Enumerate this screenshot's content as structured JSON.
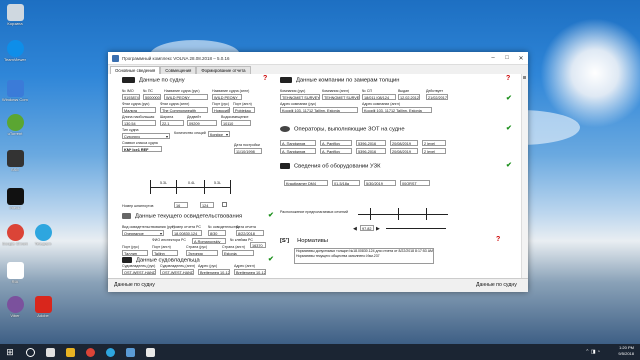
{
  "desktop": {
    "icons": [
      {
        "label": "Корзина",
        "color": "#cfd8e0"
      },
      {
        "label": "TeamViewer",
        "color": "#0e8ee9"
      },
      {
        "label": "Windows Comp.",
        "color": "#3b7bd8"
      },
      {
        "label": "uTorrent",
        "color": "#5ba632"
      },
      {
        "label": "SSE",
        "color": "#333333"
      },
      {
        "label": "IntelliJ",
        "color": "#111111"
      },
      {
        "label": "Google Chrome",
        "color": "#db4437"
      },
      {
        "label": "Telegram",
        "color": "#2ea6df"
      },
      {
        "label": "RIA",
        "color": "#ffffff"
      },
      {
        "label": "Viber",
        "color": "#7b519d"
      },
      {
        "label": "Adobe",
        "color": "#d9261c"
      }
    ]
  },
  "window": {
    "title": "Программный комплекс VOLNA 28.08.2018 – 5.0.16",
    "tabs": [
      "Основные сведения",
      "Совмещения",
      "Формирование отчета"
    ],
    "footer_left": "Данные по судну",
    "footer_right": "Данные по судну"
  },
  "vessel": {
    "title": "Данные по судну",
    "lbl_imo": "№ IMO",
    "imo": "9193874",
    "lbl_no": "№ ПС",
    "no": "5000000",
    "lbl_name": "Название судна (рус)",
    "name": "WILD PEONY",
    "lbl_name_en": "Название судна (англ)",
    "name_en": "WILD PEONY",
    "lbl_flag_ru": "Флаг судна (рус)",
    "flag_ru": "Мальта",
    "lbl_flag_en": "Флаг судна (англ)",
    "flag_en": "The Commonwealth",
    "lbl_port_ru": "Порт (рус)",
    "port_ru": "Новосиб",
    "lbl_port_en": "Порт (англ)",
    "port_en": "Pobiekau",
    "lbl_len": "Длина наибольшая",
    "len": "130.54",
    "lbl_wid": "Ширина",
    "wid": "22.1",
    "lbl_dead": "Дедвейт",
    "dead": "09209",
    "lbl_disp": "Водоизмещение",
    "disp": "10110",
    "lbl_type": "Тип судна",
    "type": "Сухогруз",
    "lbl_sect": "Количество секций",
    "sect": "Конфиг",
    "lbl_class": "Символ класса судна",
    "class": "KM* Ice1 REF",
    "lbl_date": "Дата постройки",
    "date": "11/10/1998",
    "lbl_num": "Номер шпангоутов",
    "num1": "16",
    "num2": "124",
    "d1": "5.3L",
    "d2": "0.4L",
    "d3": "5.3L"
  },
  "company": {
    "title": "Данные компании по замерам толщин",
    "lbl_comp_ru": "Компания (рус)",
    "comp_ru": "TEHNOMET SURVEY",
    "lbl_comp_en": "Компания (англ)",
    "comp_en": "TEHNOMET SURVEY",
    "lbl_cert": "№ СП",
    "cert": "18/011 I08/124",
    "lbl_issued": "Выдан",
    "issued": "12.02.2012",
    "lbl_valid": "Действует",
    "valid": "21/02/2017",
    "lbl_addr_ru": "Адрес компании (рус)",
    "addr_ru": "Kooplii 103, 11712 Tallinn, Estonia",
    "lbl_addr_en": "Адрес компании (англ)",
    "addr_en": "Kooplii 103, 11712 Tallinn, Estonia"
  },
  "operators": {
    "title": "Операторы, выполняющие ЗОТ на судне",
    "rows": [
      {
        "ru": "А. Панфилов",
        "en": "A. Panfilov",
        "no": "5396-2016",
        "date": "20/08/2019",
        "level": "2 level"
      },
      {
        "ru": "А. Панфилов",
        "en": "A. Panfilov",
        "no": "5396-2016",
        "date": "20/08/2019",
        "level": "2 level"
      }
    ]
  },
  "equipment": {
    "title": "Сведения об оборудовании УЗК",
    "name": "Krautkramer DM4",
    "serial": "01-5/18a",
    "date": "5/30/2019",
    "cert": "00ORST"
  },
  "certificate": {
    "title": "Данные текущего освидетельствования",
    "lbl_kind": "Вид освидетельствования (рус)",
    "kind": "Очередное",
    "lbl_report": "Номер отчета РС",
    "report": "18.00830.124",
    "lbl_survey": "№ освидетельство",
    "survey": "8/30",
    "lbl_date": "Дата отчета",
    "date": "8/22/2018",
    "lbl_insp": "ФИО инспектора РС",
    "insp": "А.Romanovskiy",
    "lbl_insp_no": "№ клейма РС",
    "insp_no": "16370",
    "lbl_place_ru": "Порт (рус)",
    "place_ru": "Таллин",
    "lbl_place_en": "Порт (англ)",
    "place_en": "Tallinn",
    "lbl_country_ru": "Страна (рус)",
    "country_ru": "Эстония",
    "lbl_country_en": "Страна (англ)",
    "country_en": "Estonia"
  },
  "owner": {
    "title": "Данные судовладельца",
    "lbl_ru": "Судовладелец (рус)",
    "ru": "OST-WEST-HANDE",
    "lbl_en": "Судовладелец (англ)",
    "en": "OST-WEST-HANDE",
    "lbl_addr_ru": "Адрес (рус)",
    "addr_ru": "Breitenweg 10-12",
    "lbl_addr_en": "Адрес (англ)",
    "addr_en": "Breitenweg 10-12"
  },
  "sections": {
    "title": "Расположение предполагаемых сечений",
    "value": "97.82"
  },
  "norms": {
    "badge": "[S']",
    "title": "Нормативы",
    "text1": "Нормативы допустимых толщин №18.00830.124 для отчета от 8/22/2018 8:17:53 AM",
    "text2": "Нормативы текущего общества заполнено Изм.237"
  },
  "taskbar": {
    "time": "1:20 PM",
    "date": "9/5/2018",
    "apps": [
      "#e0e0e0",
      "#3b7bd8",
      "#e8b323",
      "#db4437",
      "#2ea6df",
      "#5b9bd5",
      "#e8e8e8"
    ]
  }
}
